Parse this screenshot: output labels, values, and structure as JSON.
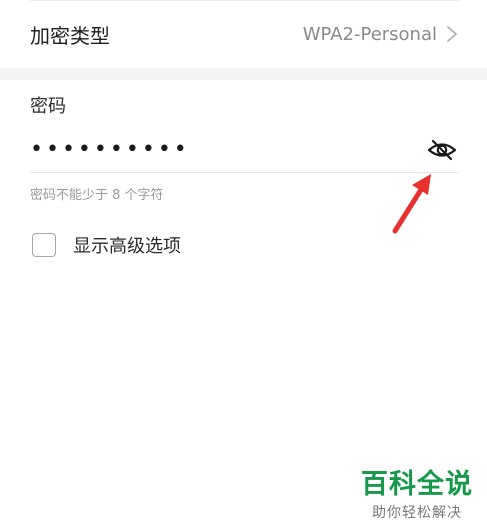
{
  "security": {
    "label": "加密类型",
    "value": "WPA2-Personal",
    "chevron_icon": "chevron-right-icon"
  },
  "password": {
    "title": "密码",
    "masked_value": "••••••••••",
    "toggle_icon": "eye-icon",
    "hint": "密码不能少于 8 个字符"
  },
  "advanced": {
    "checked": false,
    "label": "显示高级选项"
  },
  "annotation": {
    "arrow_color": "#e8312d"
  },
  "watermark": {
    "title": "百科全说",
    "subtitle": "助你轻松解决",
    "color": "#16994a"
  }
}
